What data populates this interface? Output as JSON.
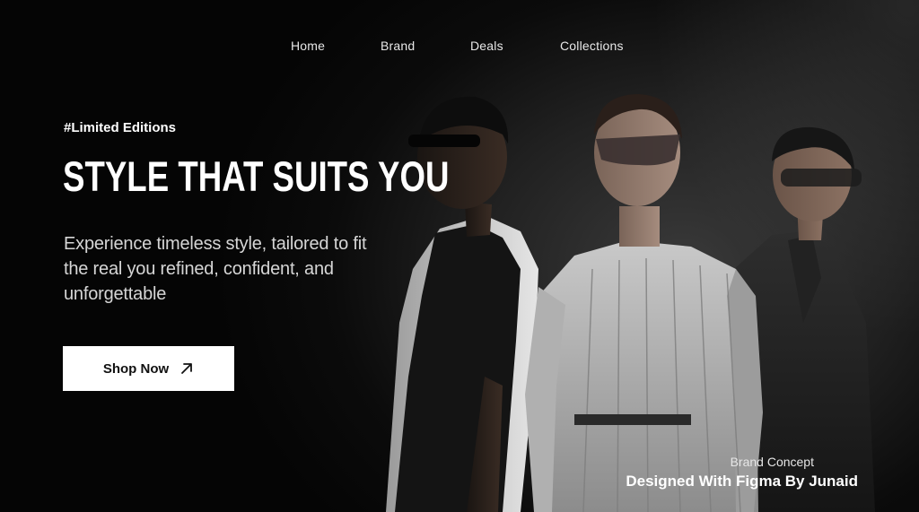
{
  "nav": {
    "items": [
      {
        "label": "Home"
      },
      {
        "label": "Brand"
      },
      {
        "label": "Deals"
      },
      {
        "label": "Collections"
      }
    ]
  },
  "hero": {
    "tag": "#Limited Editions",
    "headline": "STYLE THAT SUITS YOU",
    "subtext": "Experience timeless style, tailored to fit the real you refined, confident, and unforgettable",
    "cta_label": "Shop Now",
    "cta_icon": "arrow-up-right-icon"
  },
  "credit": {
    "small": "Brand Concept",
    "big": "Designed With Figma By Junaid"
  },
  "colors": {
    "background": "#000000",
    "text": "#ffffff",
    "button_bg": "#ffffff",
    "button_text": "#111111"
  }
}
